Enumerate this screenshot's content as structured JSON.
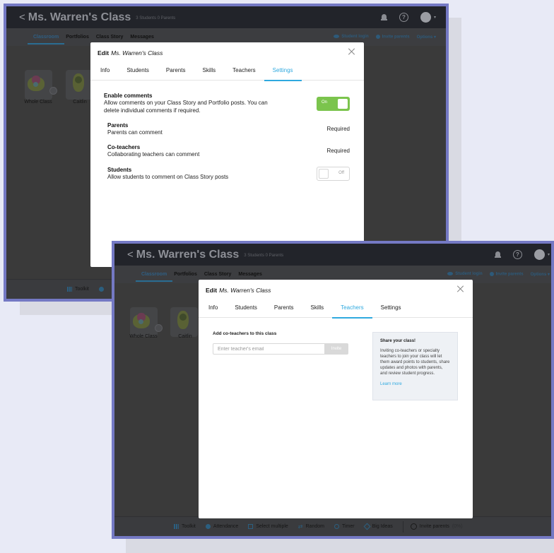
{
  "app": {
    "class_title": "Ms. Warren's Class",
    "class_subtitle": "3 Students   0 Parents",
    "back_glyph": "<"
  },
  "nav": {
    "tabs": [
      "Classroom",
      "Portfolios",
      "Class Story",
      "Messages"
    ],
    "student_login": "Student login",
    "invite_parents": "Invite parents",
    "options": "Options",
    "options_caret": "▾"
  },
  "tiles": [
    {
      "label": "Whole Class"
    },
    {
      "label": "Caitlin"
    }
  ],
  "bottom_bar": {
    "toolkit": "Toolkit",
    "attendance": "Attendance",
    "select_multiple": "Select multiple",
    "random": "Random",
    "timer": "Timer",
    "big_ideas": "Big Ideas",
    "invite_parents": "Invite parents",
    "invite_parents_pct": "(0%)"
  },
  "modal": {
    "edit_label": "Edit",
    "class_name": "Ms. Warren's Class",
    "tabs": [
      "Info",
      "Students",
      "Parents",
      "Skills",
      "Teachers",
      "Settings"
    ]
  },
  "settings_panel": {
    "active_tab": "Settings",
    "enable_comments": {
      "title": "Enable comments",
      "description": "Allow comments on your Class Story and Portfolio posts. You can delete individual comments if required.",
      "toggle_label": "On",
      "enabled": true
    },
    "parents": {
      "title": "Parents",
      "description": "Parents can comment",
      "status": "Required"
    },
    "coteachers": {
      "title": "Co-teachers",
      "description": "Collaborating teachers can comment",
      "status": "Required"
    },
    "students": {
      "title": "Students",
      "description": "Allow students to comment on Class Story posts",
      "toggle_label": "Off",
      "enabled": false
    }
  },
  "teachers_panel": {
    "active_tab": "Teachers",
    "add_title": "Add co-teachers to this class",
    "email_placeholder": "Enter teacher's email",
    "invite_button": "Invite",
    "share_title": "Share your class!",
    "share_body": "Inviting co-teachers or specialty teachers to join your class will let them award points to students, share updates and photos with parents, and review student progress.",
    "learn_more": "Learn more"
  },
  "colors": {
    "frame": "#7479c4",
    "accent_blue": "#2fa9df",
    "toggle_green": "#7bc44d",
    "background": "#e8eaf6"
  }
}
